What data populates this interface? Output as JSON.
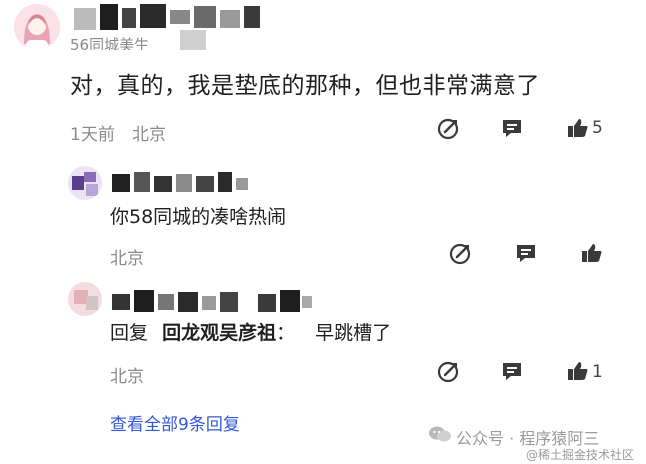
{
  "comment": {
    "username_partial": "56同城美生",
    "text": "对，真的，我是垫底的那种，但也非常满意了",
    "time": "1天前",
    "location": "北京",
    "like_count": "5"
  },
  "replies": [
    {
      "text": "你58同城的凑啥热闹",
      "location": "北京",
      "like_count": ""
    },
    {
      "prefix": "回复",
      "reply_to": "回龙观吴彦祖",
      "separator": "：",
      "text": "早跳槽了",
      "location": "北京",
      "like_count": "1"
    }
  ],
  "view_all": "查看全部9条回复",
  "watermark": {
    "account": "公众号 · 程序猿阿三",
    "site": "@稀土掘金技术社区"
  },
  "colors": {
    "link": "#3558d6",
    "meta": "#8a8a8a",
    "icon": "#3a3a3a"
  },
  "icons": [
    "edit-icon",
    "comment-icon",
    "thumbs-up-icon"
  ]
}
